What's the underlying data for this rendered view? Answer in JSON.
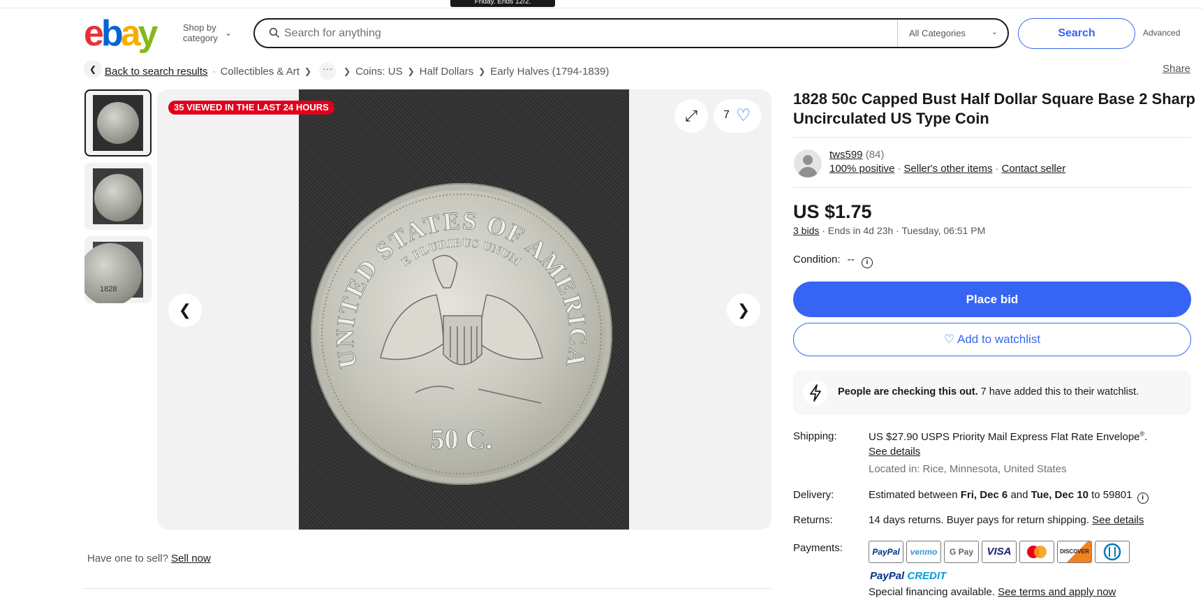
{
  "header": {
    "promo_tab": "Friday. Ends 12/2.",
    "logo": {
      "e": "e",
      "b": "b",
      "a": "a",
      "y": "y"
    },
    "shop_by_line1": "Shop by",
    "shop_by_line2": "category",
    "search_placeholder": "Search for anything",
    "category_select": "All Categories",
    "search_button": "Search",
    "advanced_link": "Advanced"
  },
  "breadcrumb": {
    "back": "Back to search results",
    "items": [
      "Collectibles & Art",
      "Coins: US",
      "Half Dollars",
      "Early Halves (1794-1839)"
    ],
    "share": "Share"
  },
  "gallery": {
    "viewed_badge": "35 VIEWED IN THE LAST 24 HOURS",
    "watch_count": "7",
    "coin_legend_top": "UNITED STATES OF AMERICA",
    "coin_motto": "E PLURIBUS UNUM",
    "coin_denomination": "50 C.",
    "thumb3_date": "1828"
  },
  "sell": {
    "text": "Have one to sell?",
    "link": "Sell now"
  },
  "item": {
    "title": "1828 50c Capped Bust Half Dollar Square Base 2 Sharp Uncirculated US Type Coin",
    "seller": {
      "name": "tws599",
      "feedback_count": "(84)",
      "positive": "100% positive",
      "other_items": "Seller's other items",
      "contact": "Contact seller"
    },
    "price": "US $1.75",
    "bids": "3 bids",
    "ends": "· Ends in 4d 23h · Tuesday, 06:51 PM",
    "condition_label": "Condition:",
    "condition_value": "--",
    "place_bid": "Place bid",
    "add_watchlist": "Add to watchlist",
    "urgency_bold": "People are checking this out.",
    "urgency_rest": "7 have added this to their watchlist."
  },
  "specs": {
    "shipping_label": "Shipping:",
    "shipping_price": "US $27.90",
    "shipping_method": "USPS Priority Mail Express Flat Rate Envelope",
    "shipping_reg": "®",
    "see_details": "See details",
    "located": "Located in: Rice, Minnesota, United States",
    "delivery_label": "Delivery:",
    "delivery_pre": "Estimated between",
    "delivery_from": "Fri, Dec 6",
    "delivery_and": "and",
    "delivery_to": "Tue, Dec 10",
    "delivery_zip": "to 59801",
    "returns_label": "Returns:",
    "returns_text": "14 days returns. Buyer pays for return shipping.",
    "returns_link": "See details",
    "payments_label": "Payments:",
    "payment_methods": [
      "PayPal",
      "venmo",
      "G Pay",
      "VISA",
      "",
      "DISCOVER",
      "D"
    ],
    "paypal_credit_a": "PayPal",
    "paypal_credit_b": "CREDIT",
    "financing_text": "Special financing available.",
    "financing_link": "See terms and apply now"
  },
  "colors": {
    "accent": "#3665f3",
    "badge": "#e0001b",
    "logo_e": "#e53238",
    "logo_b": "#0064d2",
    "logo_a": "#f5af02",
    "logo_y": "#86b817"
  }
}
